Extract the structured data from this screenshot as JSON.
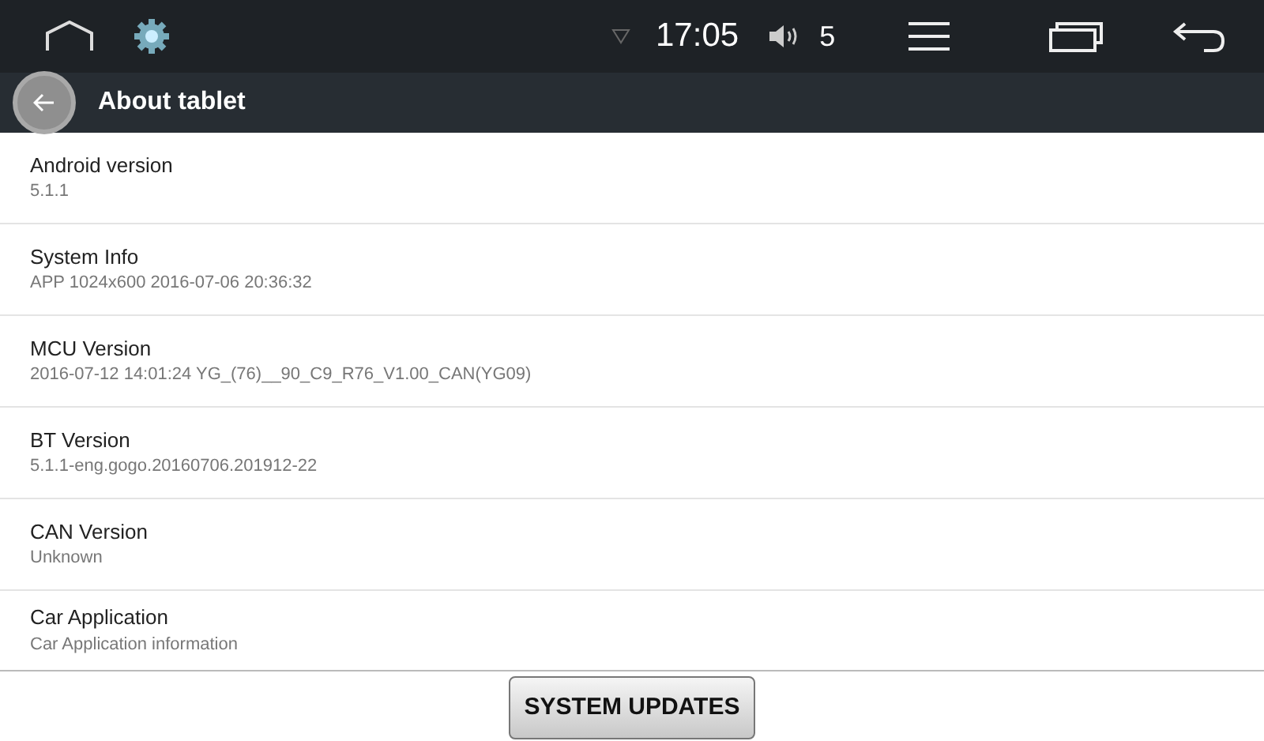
{
  "status_bar": {
    "time": "17:05",
    "volume": "5"
  },
  "action_bar": {
    "title": "About tablet"
  },
  "items": [
    {
      "title": "Android version",
      "summary": "5.1.1"
    },
    {
      "title": "System Info",
      "summary": "APP 1024x600 2016-07-06 20:36:32"
    },
    {
      "title": "MCU Version",
      "summary": "2016-07-12 14:01:24 YG_(76)__90_C9_R76_V1.00_CAN(YG09)"
    },
    {
      "title": "BT Version",
      "summary": "5.1.1-eng.gogo.20160706.201912-22"
    },
    {
      "title": "CAN Version",
      "summary": "Unknown"
    },
    {
      "title": "Car Application",
      "summary": "Car Application information"
    }
  ],
  "footer_button": "SYSTEM UPDATES"
}
